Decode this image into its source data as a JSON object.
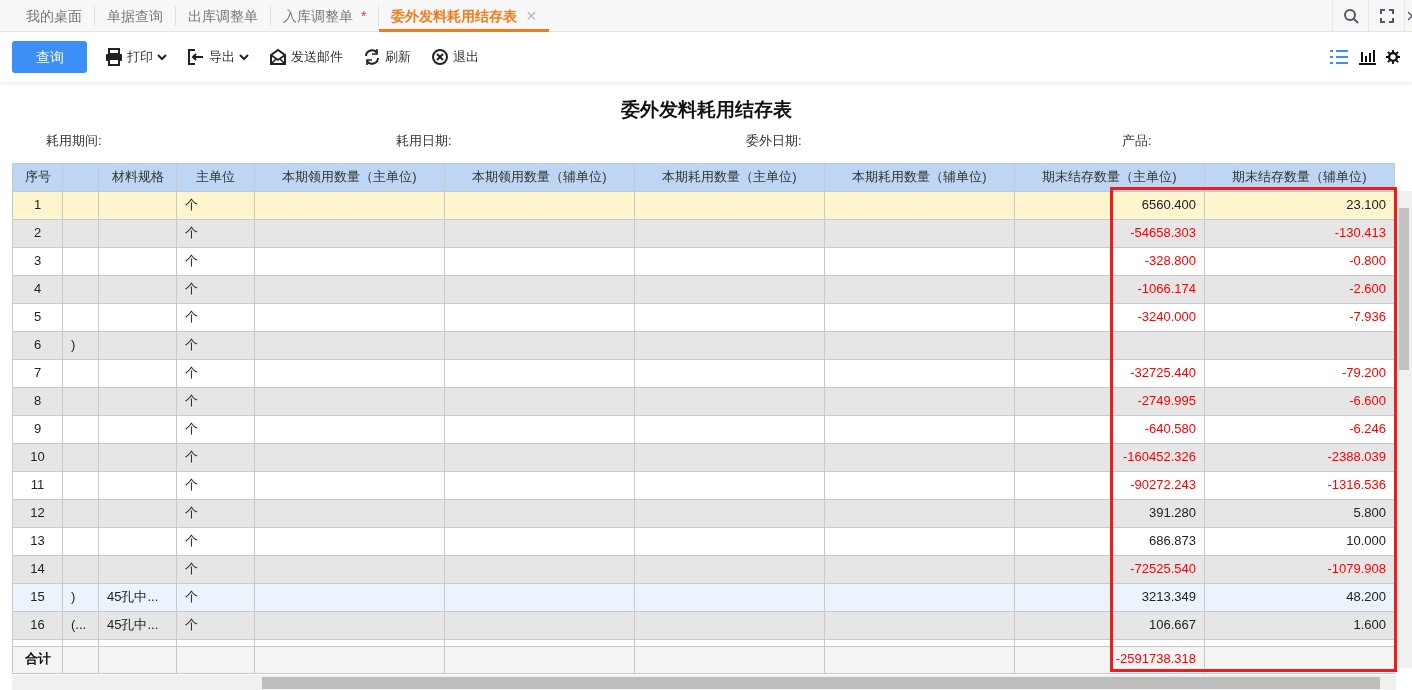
{
  "tabs": [
    {
      "label": "我的桌面",
      "selected": false,
      "modified": false
    },
    {
      "label": "单据查询",
      "selected": false,
      "modified": false
    },
    {
      "label": "出库调整单",
      "selected": false,
      "modified": false
    },
    {
      "label": "入库调整单",
      "selected": false,
      "modified": true,
      "modified_mark": "*"
    },
    {
      "label": "委外发料耗用结存表",
      "selected": true,
      "modified": false,
      "close": "✕"
    }
  ],
  "toolbar": [
    {
      "label": "查询",
      "kind": "primary"
    },
    {
      "label": "打印",
      "kind": "print",
      "dropdown": true
    },
    {
      "label": "导出",
      "kind": "export",
      "dropdown": true
    },
    {
      "label": "发送邮件",
      "kind": "mail",
      "dropdown": false
    },
    {
      "label": "刷新",
      "kind": "refresh",
      "dropdown": false
    },
    {
      "label": "退出",
      "kind": "exit",
      "dropdown": false
    }
  ],
  "view_toggle": [
    {
      "kind": "list",
      "selected": true
    },
    {
      "kind": "chart",
      "selected": false
    }
  ],
  "report": {
    "title": "委外发料耗用结存表",
    "filters": [
      {
        "label": "耗用期间:"
      },
      {
        "label": "耗用日期:"
      },
      {
        "label": "委外日期:"
      },
      {
        "label": "产品:"
      }
    ]
  },
  "table": {
    "columns": [
      "序号",
      "",
      "材料规格",
      "主单位",
      "本期领用数量（主单位)",
      "本期领用数量（辅单位)",
      "本期耗用数量（主单位)",
      "本期耗用数量（辅单位)",
      "期末结存数量（主单位)",
      "期末结存数量（辅单位)"
    ],
    "rows": [
      {
        "seq": "1",
        "col_2": "",
        "spec": "",
        "unit": "个",
        "end_main": {
          "text": "6560.400",
          "color": "#222222"
        },
        "end_aux": {
          "text": "23.100",
          "color": "#222222"
        },
        "selected": true,
        "hovered": false
      },
      {
        "seq": "2",
        "col_2": "",
        "spec": "",
        "unit": "个",
        "end_main": {
          "text": "-54658.303",
          "color": "#ff0000"
        },
        "end_aux": {
          "text": "-130.413",
          "color": "#ff0000"
        },
        "selected": false,
        "hovered": false
      },
      {
        "seq": "3",
        "col_2": "",
        "spec": "",
        "unit": "个",
        "end_main": {
          "text": "-328.800",
          "color": "#ff0000"
        },
        "end_aux": {
          "text": "-0.800",
          "color": "#ff0000"
        },
        "selected": false,
        "hovered": false
      },
      {
        "seq": "4",
        "col_2": "",
        "spec": "",
        "unit": "个",
        "end_main": {
          "text": "-1066.174",
          "color": "#ff0000"
        },
        "end_aux": {
          "text": "-2.600",
          "color": "#ff0000"
        },
        "selected": false,
        "hovered": false
      },
      {
        "seq": "5",
        "col_2": "",
        "spec": "",
        "unit": "个",
        "end_main": {
          "text": "-3240.000",
          "color": "#ff0000"
        },
        "end_aux": {
          "text": "-7.936",
          "color": "#ff0000"
        },
        "selected": false,
        "hovered": false
      },
      {
        "seq": "6",
        "col_2": ")",
        "spec": "",
        "unit": "个",
        "selected": false,
        "hovered": false
      },
      {
        "seq": "7",
        "col_2": "",
        "spec": "",
        "unit": "个",
        "end_main": {
          "text": "-32725.440",
          "color": "#ff0000"
        },
        "end_aux": {
          "text": "-79.200",
          "color": "#ff0000"
        },
        "selected": false,
        "hovered": false
      },
      {
        "seq": "8",
        "col_2": "",
        "spec": "",
        "unit": "个",
        "end_main": {
          "text": "-2749.995",
          "color": "#ff0000"
        },
        "end_aux": {
          "text": "-6.600",
          "color": "#ff0000"
        },
        "selected": false,
        "hovered": false
      },
      {
        "seq": "9",
        "col_2": "",
        "spec": "",
        "unit": "个",
        "end_main": {
          "text": "-640.580",
          "color": "#ff0000"
        },
        "end_aux": {
          "text": "-6.246",
          "color": "#ff0000"
        },
        "selected": false,
        "hovered": false
      },
      {
        "seq": "10",
        "col_2": "",
        "spec": "",
        "unit": "个",
        "end_main": {
          "text": "-160452.326",
          "color": "#ff0000"
        },
        "end_aux": {
          "text": "-2388.039",
          "color": "#ff0000"
        },
        "selected": false,
        "hovered": false
      },
      {
        "seq": "11",
        "col_2": "",
        "spec": "",
        "unit": "个",
        "end_main": {
          "text": "-90272.243",
          "color": "#ff0000"
        },
        "end_aux": {
          "text": "-1316.536",
          "color": "#ff0000"
        },
        "selected": false,
        "hovered": false
      },
      {
        "seq": "12",
        "col_2": "",
        "spec": "",
        "unit": "个",
        "end_main": {
          "text": "391.280",
          "color": "#222222"
        },
        "end_aux": {
          "text": "5.800",
          "color": "#222222"
        },
        "selected": false,
        "hovered": false
      },
      {
        "seq": "13",
        "col_2": "",
        "spec": "",
        "unit": "个",
        "end_main": {
          "text": "686.873",
          "color": "#222222"
        },
        "end_aux": {
          "text": "10.000",
          "color": "#222222"
        },
        "selected": false,
        "hovered": false
      },
      {
        "seq": "14",
        "col_2": "",
        "spec": "",
        "unit": "个",
        "end_main": {
          "text": "-72525.540",
          "color": "#ff0000"
        },
        "end_aux": {
          "text": "-1079.908",
          "color": "#ff0000"
        },
        "selected": false,
        "hovered": false
      },
      {
        "seq": "15",
        "col_2": ")",
        "spec": "45孔中...",
        "unit": "个",
        "end_main": {
          "text": "3213.349",
          "color": "#222222"
        },
        "end_aux": {
          "text": "48.200",
          "color": "#222222"
        },
        "selected": false,
        "hovered": true
      },
      {
        "seq": "16",
        "col_2": "(...",
        "spec": "45孔中...",
        "unit": "个",
        "end_main": {
          "text": "106.667",
          "color": "#222222"
        },
        "end_aux": {
          "text": "1.600",
          "color": "#222222"
        },
        "selected": false,
        "hovered": false
      }
    ],
    "total": {
      "label": "合计",
      "end_main": {
        "text": "-2591738.318",
        "color": "#ff0000"
      }
    }
  }
}
